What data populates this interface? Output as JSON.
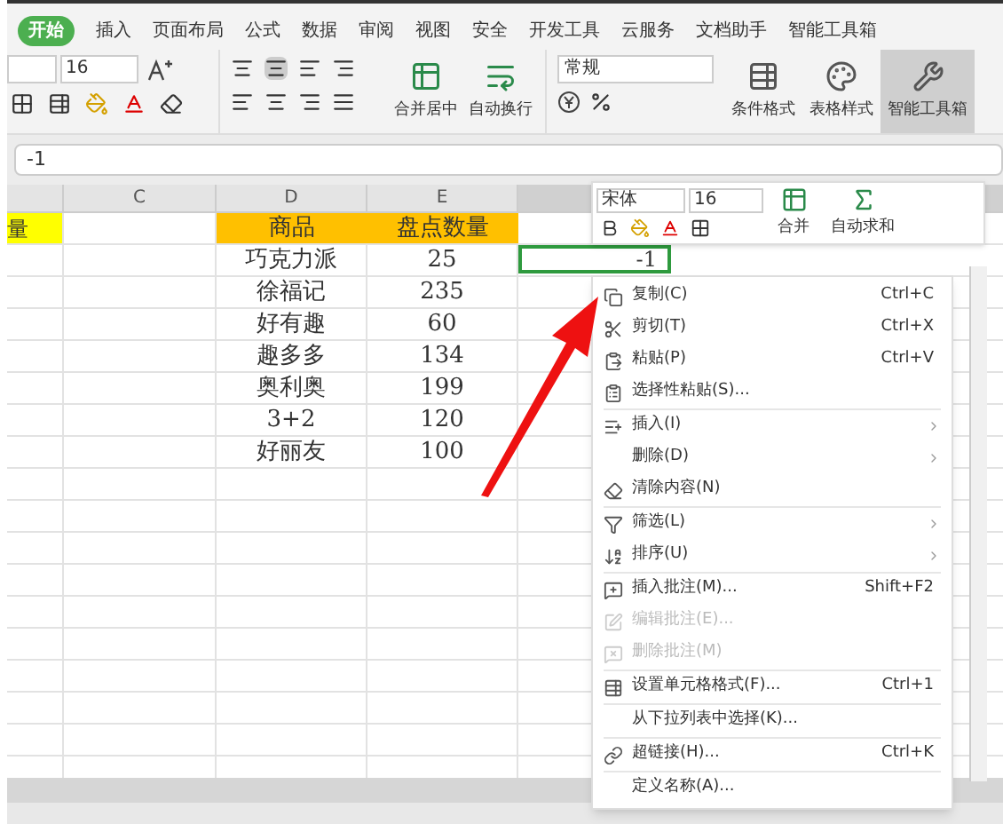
{
  "ribbon_tabs": [
    {
      "label": "开始",
      "selected": true
    },
    {
      "label": "插入",
      "selected": false
    },
    {
      "label": "页面布局",
      "selected": false
    },
    {
      "label": "公式",
      "selected": false
    },
    {
      "label": "数据",
      "selected": false
    },
    {
      "label": "审阅",
      "selected": false
    },
    {
      "label": "视图",
      "selected": false
    },
    {
      "label": "安全",
      "selected": false
    },
    {
      "label": "开发工具",
      "selected": false
    },
    {
      "label": "云服务",
      "selected": false
    },
    {
      "label": "文档助手",
      "selected": false
    },
    {
      "label": "智能工具箱",
      "selected": false
    }
  ],
  "toolbar": {
    "font_size": "16",
    "number_format": "常规",
    "big_buttons": [
      {
        "label": "合并居中",
        "kind": "merge",
        "selected": false
      },
      {
        "label": "自动换行",
        "kind": "wrap",
        "selected": false
      }
    ],
    "format_buttons": [
      {
        "label": "条件格式",
        "kind": "conditional",
        "selected": false
      },
      {
        "label": "表格样式",
        "kind": "style",
        "selected": false
      },
      {
        "label": "智能工具箱",
        "kind": "toolbox",
        "selected": true
      }
    ]
  },
  "formula_bar": {
    "value": "-1"
  },
  "sheet": {
    "columns": [
      "C",
      "D",
      "E"
    ],
    "header": {
      "partial_cell": "量",
      "item": "商品",
      "qty": "盘点数量"
    },
    "rows": [
      {
        "item": "巧克力派",
        "qty": "25"
      },
      {
        "item": "徐福记",
        "qty": "235"
      },
      {
        "item": "好有趣",
        "qty": "60"
      },
      {
        "item": "趣多多",
        "qty": "134"
      },
      {
        "item": "奥利奥",
        "qty": "199"
      },
      {
        "item": "3+2",
        "qty": "120"
      },
      {
        "item": "好丽友",
        "qty": "100"
      }
    ],
    "active_cell": "-1"
  },
  "mini_toolbar": {
    "font": "宋体",
    "font_size": "16",
    "buttons": [
      {
        "label": "合并",
        "kind": "merge"
      },
      {
        "label": "自动求和",
        "kind": "sum"
      }
    ]
  },
  "context_menu": [
    [
      {
        "label": "复制(C)",
        "shortcut": "Ctrl+C",
        "kind": "copy",
        "disabled": false,
        "submenu": false
      },
      {
        "label": "剪切(T)",
        "shortcut": "Ctrl+X",
        "kind": "cut",
        "disabled": false,
        "submenu": false
      },
      {
        "label": "粘贴(P)",
        "shortcut": "Ctrl+V",
        "kind": "paste",
        "disabled": false,
        "submenu": false
      },
      {
        "label": "选择性粘贴(S)...",
        "kind": "paste-special",
        "disabled": false,
        "submenu": false
      }
    ],
    [
      {
        "label": "插入(I)",
        "kind": "insert",
        "disabled": false,
        "submenu": true
      },
      {
        "label": "删除(D)",
        "kind": "none",
        "disabled": false,
        "submenu": true
      },
      {
        "label": "清除内容(N)",
        "kind": "clear",
        "disabled": false,
        "submenu": false
      }
    ],
    [
      {
        "label": "筛选(L)",
        "kind": "filter",
        "disabled": false,
        "submenu": true
      },
      {
        "label": "排序(U)",
        "kind": "sort",
        "disabled": false,
        "submenu": true
      }
    ],
    [
      {
        "label": "插入批注(M)...",
        "shortcut": "Shift+F2",
        "kind": "comment",
        "disabled": false,
        "submenu": false
      },
      {
        "label": "编辑批注(E)...",
        "kind": "edit-comment",
        "disabled": true,
        "submenu": false
      },
      {
        "label": "删除批注(M)",
        "kind": "delete-comment",
        "disabled": true,
        "submenu": false
      }
    ],
    [
      {
        "label": "设置单元格格式(F)...",
        "shortcut": "Ctrl+1",
        "kind": "format",
        "disabled": false,
        "submenu": false
      }
    ],
    [
      {
        "label": "从下拉列表中选择(K)...",
        "kind": "none",
        "disabled": false,
        "submenu": false
      }
    ],
    [
      {
        "label": "超链接(H)...",
        "shortcut": "Ctrl+K",
        "kind": "link",
        "disabled": false,
        "submenu": false
      }
    ],
    [
      {
        "label": "定义名称(A)...",
        "kind": "none",
        "disabled": false,
        "submenu": false
      }
    ]
  ]
}
